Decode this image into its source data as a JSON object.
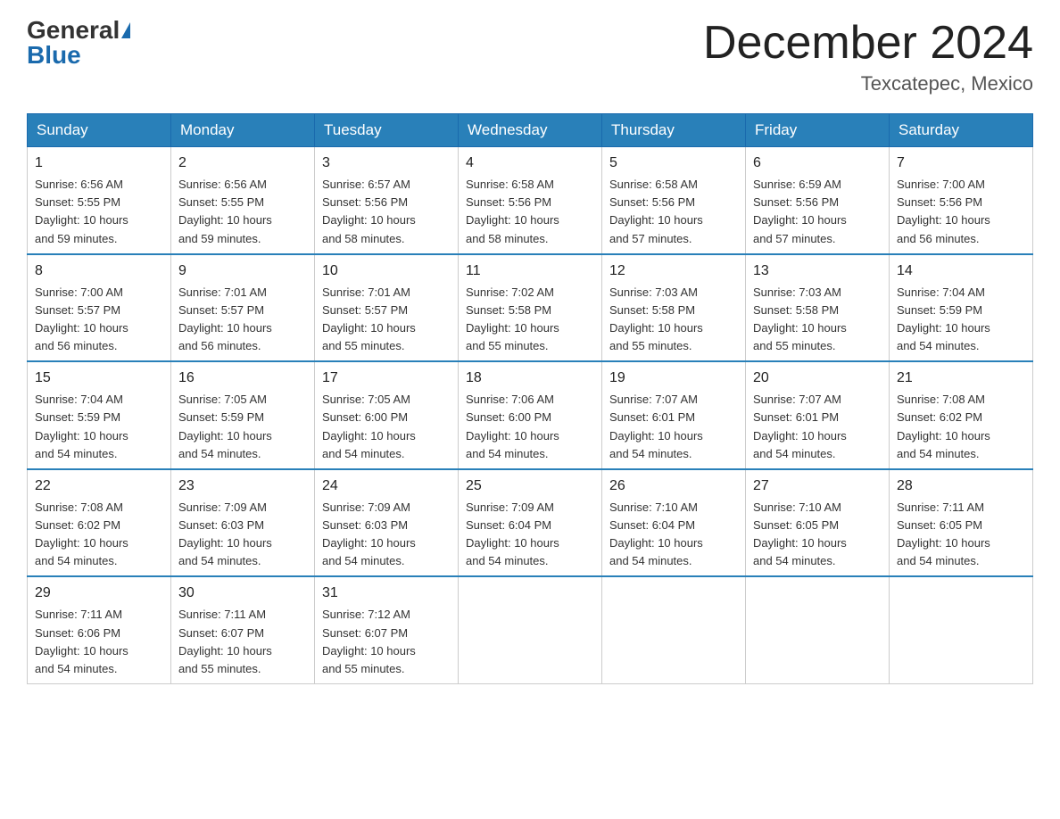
{
  "header": {
    "logo_general": "General",
    "logo_blue": "Blue",
    "month_title": "December 2024",
    "location": "Texcatepec, Mexico"
  },
  "calendar": {
    "days_of_week": [
      "Sunday",
      "Monday",
      "Tuesday",
      "Wednesday",
      "Thursday",
      "Friday",
      "Saturday"
    ],
    "weeks": [
      [
        {
          "day": "1",
          "sunrise": "6:56 AM",
          "sunset": "5:55 PM",
          "daylight": "10 hours and 59 minutes."
        },
        {
          "day": "2",
          "sunrise": "6:56 AM",
          "sunset": "5:55 PM",
          "daylight": "10 hours and 59 minutes."
        },
        {
          "day": "3",
          "sunrise": "6:57 AM",
          "sunset": "5:56 PM",
          "daylight": "10 hours and 58 minutes."
        },
        {
          "day": "4",
          "sunrise": "6:58 AM",
          "sunset": "5:56 PM",
          "daylight": "10 hours and 58 minutes."
        },
        {
          "day": "5",
          "sunrise": "6:58 AM",
          "sunset": "5:56 PM",
          "daylight": "10 hours and 57 minutes."
        },
        {
          "day": "6",
          "sunrise": "6:59 AM",
          "sunset": "5:56 PM",
          "daylight": "10 hours and 57 minutes."
        },
        {
          "day": "7",
          "sunrise": "7:00 AM",
          "sunset": "5:56 PM",
          "daylight": "10 hours and 56 minutes."
        }
      ],
      [
        {
          "day": "8",
          "sunrise": "7:00 AM",
          "sunset": "5:57 PM",
          "daylight": "10 hours and 56 minutes."
        },
        {
          "day": "9",
          "sunrise": "7:01 AM",
          "sunset": "5:57 PM",
          "daylight": "10 hours and 56 minutes."
        },
        {
          "day": "10",
          "sunrise": "7:01 AM",
          "sunset": "5:57 PM",
          "daylight": "10 hours and 55 minutes."
        },
        {
          "day": "11",
          "sunrise": "7:02 AM",
          "sunset": "5:58 PM",
          "daylight": "10 hours and 55 minutes."
        },
        {
          "day": "12",
          "sunrise": "7:03 AM",
          "sunset": "5:58 PM",
          "daylight": "10 hours and 55 minutes."
        },
        {
          "day": "13",
          "sunrise": "7:03 AM",
          "sunset": "5:58 PM",
          "daylight": "10 hours and 55 minutes."
        },
        {
          "day": "14",
          "sunrise": "7:04 AM",
          "sunset": "5:59 PM",
          "daylight": "10 hours and 54 minutes."
        }
      ],
      [
        {
          "day": "15",
          "sunrise": "7:04 AM",
          "sunset": "5:59 PM",
          "daylight": "10 hours and 54 minutes."
        },
        {
          "day": "16",
          "sunrise": "7:05 AM",
          "sunset": "5:59 PM",
          "daylight": "10 hours and 54 minutes."
        },
        {
          "day": "17",
          "sunrise": "7:05 AM",
          "sunset": "6:00 PM",
          "daylight": "10 hours and 54 minutes."
        },
        {
          "day": "18",
          "sunrise": "7:06 AM",
          "sunset": "6:00 PM",
          "daylight": "10 hours and 54 minutes."
        },
        {
          "day": "19",
          "sunrise": "7:07 AM",
          "sunset": "6:01 PM",
          "daylight": "10 hours and 54 minutes."
        },
        {
          "day": "20",
          "sunrise": "7:07 AM",
          "sunset": "6:01 PM",
          "daylight": "10 hours and 54 minutes."
        },
        {
          "day": "21",
          "sunrise": "7:08 AM",
          "sunset": "6:02 PM",
          "daylight": "10 hours and 54 minutes."
        }
      ],
      [
        {
          "day": "22",
          "sunrise": "7:08 AM",
          "sunset": "6:02 PM",
          "daylight": "10 hours and 54 minutes."
        },
        {
          "day": "23",
          "sunrise": "7:09 AM",
          "sunset": "6:03 PM",
          "daylight": "10 hours and 54 minutes."
        },
        {
          "day": "24",
          "sunrise": "7:09 AM",
          "sunset": "6:03 PM",
          "daylight": "10 hours and 54 minutes."
        },
        {
          "day": "25",
          "sunrise": "7:09 AM",
          "sunset": "6:04 PM",
          "daylight": "10 hours and 54 minutes."
        },
        {
          "day": "26",
          "sunrise": "7:10 AM",
          "sunset": "6:04 PM",
          "daylight": "10 hours and 54 minutes."
        },
        {
          "day": "27",
          "sunrise": "7:10 AM",
          "sunset": "6:05 PM",
          "daylight": "10 hours and 54 minutes."
        },
        {
          "day": "28",
          "sunrise": "7:11 AM",
          "sunset": "6:05 PM",
          "daylight": "10 hours and 54 minutes."
        }
      ],
      [
        {
          "day": "29",
          "sunrise": "7:11 AM",
          "sunset": "6:06 PM",
          "daylight": "10 hours and 54 minutes."
        },
        {
          "day": "30",
          "sunrise": "7:11 AM",
          "sunset": "6:07 PM",
          "daylight": "10 hours and 55 minutes."
        },
        {
          "day": "31",
          "sunrise": "7:12 AM",
          "sunset": "6:07 PM",
          "daylight": "10 hours and 55 minutes."
        },
        null,
        null,
        null,
        null
      ]
    ]
  },
  "labels": {
    "sunrise": "Sunrise:",
    "sunset": "Sunset:",
    "daylight": "Daylight:"
  }
}
